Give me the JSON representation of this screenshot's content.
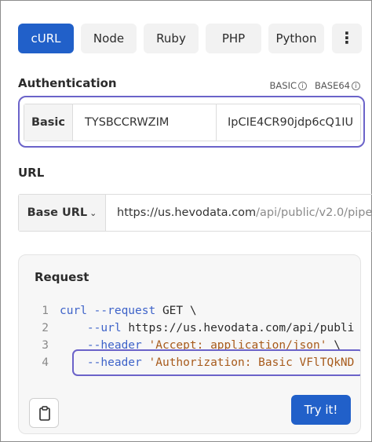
{
  "language_tabs": [
    {
      "label": "cURL",
      "active": true
    },
    {
      "label": "Node",
      "active": false
    },
    {
      "label": "Ruby",
      "active": false
    },
    {
      "label": "PHP",
      "active": false
    },
    {
      "label": "Python",
      "active": false
    }
  ],
  "more_menu_glyph": "⋮",
  "authentication": {
    "title": "Authentication",
    "types": [
      "BASIC",
      "BASE64"
    ],
    "scheme_label": "Basic",
    "username": "TYSBCCRWZIM",
    "password": "IpCIE4CR90jdp6cQ1IU"
  },
  "url_section": {
    "title": "URL",
    "base_url_label": "Base URL",
    "base": "https://us.hevodata.com",
    "path": "/api/public/v2.0/pipel"
  },
  "request": {
    "title": "Request",
    "lines": [
      {
        "num": "1",
        "parts": [
          [
            "kw",
            "curl --request "
          ],
          [
            "plain",
            "GET \\"
          ]
        ]
      },
      {
        "num": "2",
        "parts": [
          [
            "plain",
            "    "
          ],
          [
            "kw",
            "--url "
          ],
          [
            "plain",
            "https://us.hevodata.com/api/publi"
          ]
        ]
      },
      {
        "num": "3",
        "parts": [
          [
            "plain",
            "    "
          ],
          [
            "kw",
            "--header "
          ],
          [
            "str",
            "'Accept: application/json'"
          ],
          [
            "plain",
            " \\"
          ]
        ]
      },
      {
        "num": "4",
        "parts": [
          [
            "plain",
            "    "
          ],
          [
            "kw",
            "--header "
          ],
          [
            "str",
            "'Authorization: Basic VFlTQkND"
          ]
        ]
      }
    ],
    "try_button_label": "Try it!"
  },
  "icons": {
    "copy": "clipboard-icon",
    "info": "info-icon",
    "more": "more-vertical-icon",
    "dropdown": "chevron-down-icon"
  },
  "colors": {
    "accent": "#2160c9",
    "highlight_border": "#6b63c9"
  }
}
